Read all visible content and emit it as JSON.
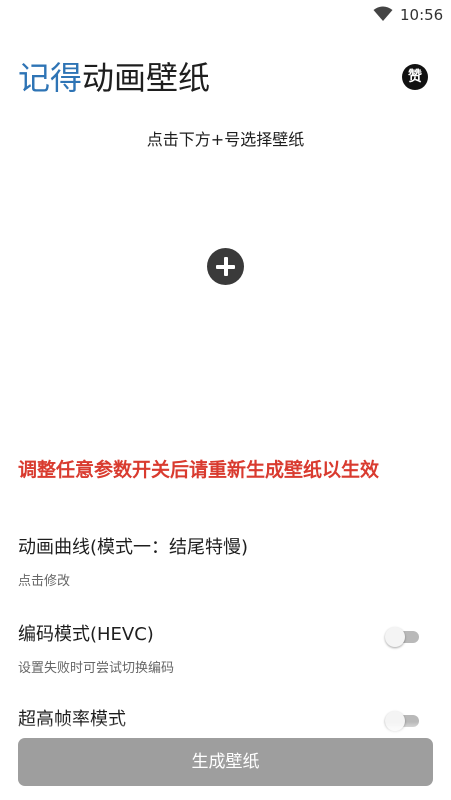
{
  "status_bar": {
    "time": "10:56",
    "wifi_icon": "wifi-icon"
  },
  "header": {
    "title_accent": "记得",
    "title_main": "动画壁纸",
    "accent_color": "#2e74b5",
    "like_badge": "赞"
  },
  "wallpaper_picker": {
    "hint": "点击下方+号选择壁纸",
    "add_icon": "plus-circle-icon"
  },
  "warning": {
    "text": "调整任意参数开关后请重新生成壁纸以生效",
    "color": "#d93b2f"
  },
  "settings": [
    {
      "title": "动画曲线(模式一：结尾特慢)",
      "subtitle": "点击修改"
    },
    {
      "title": "编码模式(HEVC)",
      "subtitle": "设置失败时可尝试切换编码",
      "toggle_on": false
    },
    {
      "title": "超高帧率模式",
      "toggle_on": false
    }
  ],
  "footer": {
    "generate_label": "生成壁纸"
  }
}
